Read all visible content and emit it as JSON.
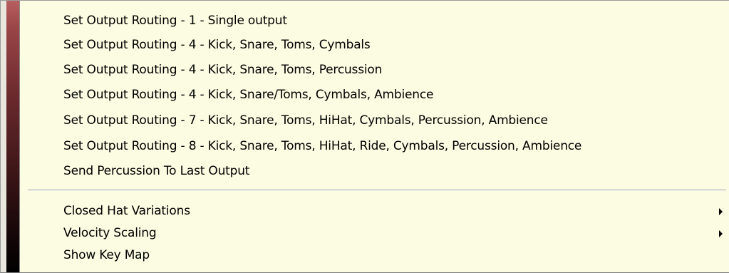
{
  "menu": {
    "routing_items": [
      {
        "label": "Set Output Routing - 1 - Single output"
      },
      {
        "label": "Set Output Routing - 4 - Kick, Snare, Toms, Cymbals"
      },
      {
        "label": "Set Output Routing - 4 - Kick, Snare, Toms, Percussion"
      },
      {
        "label": "Set Output Routing - 4 - Kick, Snare/Toms, Cymbals, Ambience"
      },
      {
        "label": "Set Output Routing - 7 - Kick, Snare, Toms, HiHat, Cymbals, Percussion, Ambience"
      },
      {
        "label": "Set Output Routing - 8 - Kick, Snare, Toms, HiHat, Ride, Cymbals, Percussion, Ambience"
      },
      {
        "label": "Send Percussion To Last Output"
      }
    ],
    "other_items": [
      {
        "label": "Closed Hat Variations",
        "submenu_icon": "submenu-arrow-icon"
      },
      {
        "label": "Velocity Scaling",
        "submenu_icon": "submenu-arrow-icon"
      },
      {
        "label": "Show Key Map"
      }
    ]
  },
  "colors": {
    "menu_background": "#fcfce3",
    "sidebar_top": "#b85f60",
    "sidebar_bottom": "#000000",
    "text": "#000000"
  }
}
